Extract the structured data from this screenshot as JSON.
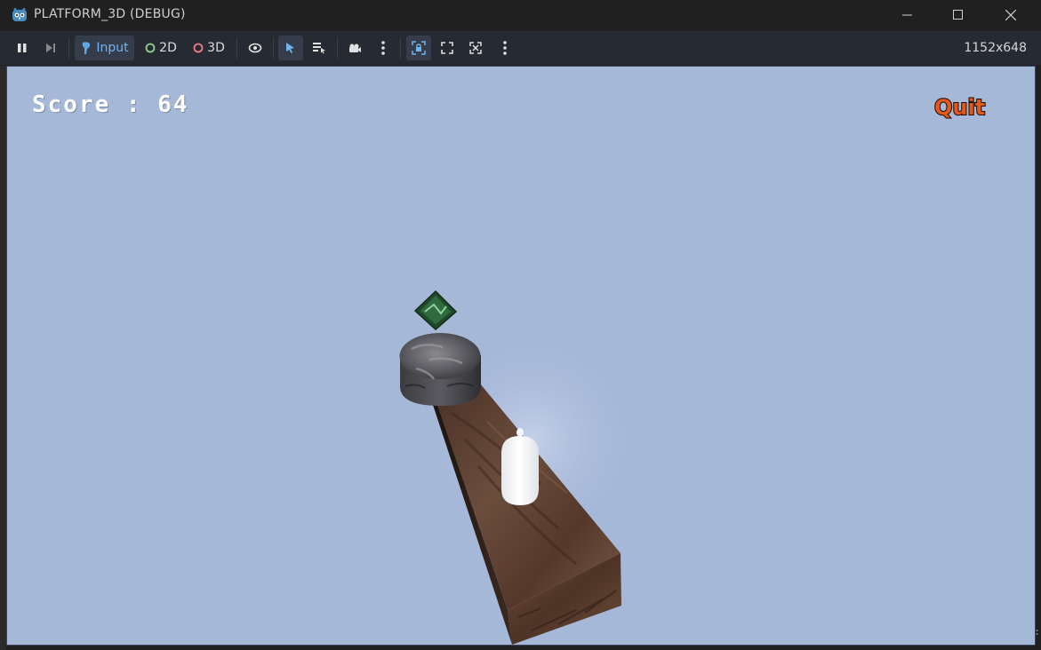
{
  "window": {
    "title": "PLATFORM_3D (DEBUG)",
    "controls": [
      "minimize",
      "maximize",
      "close"
    ]
  },
  "toolbar": {
    "buttons": [
      {
        "name": "pause",
        "icon": "pause-icon"
      },
      {
        "name": "next-frame",
        "icon": "next-frame-icon"
      },
      {
        "name": "input",
        "icon": "input-icon",
        "label": "Input",
        "active": true
      },
      {
        "name": "2d",
        "icon": "circle-icon",
        "label": "2D",
        "color": "#8fd18a"
      },
      {
        "name": "3d",
        "icon": "circle-icon",
        "label": "3D",
        "color": "#f07b87"
      },
      {
        "name": "visibility",
        "icon": "eye-icon"
      },
      {
        "name": "select",
        "icon": "cursor-icon",
        "active": true
      },
      {
        "name": "list-select",
        "icon": "list-icon"
      },
      {
        "name": "camera",
        "icon": "camera-icon"
      },
      {
        "name": "more-1",
        "icon": "more-vertical-icon"
      },
      {
        "name": "camera-override",
        "icon": "camera-lock-icon",
        "active": true
      },
      {
        "name": "fullscreen",
        "icon": "expand-icon"
      },
      {
        "name": "fit",
        "icon": "fit-icon"
      },
      {
        "name": "more-2",
        "icon": "more-vertical-icon"
      }
    ],
    "input_label": "Input",
    "label_2d": "2D",
    "label_3d": "3D",
    "resolution": "1152x648"
  },
  "game": {
    "score_text": "Score : 64",
    "quit_label": "Quit",
    "sky_color": "#a6b8d8",
    "quit_color": "#e2591b"
  }
}
